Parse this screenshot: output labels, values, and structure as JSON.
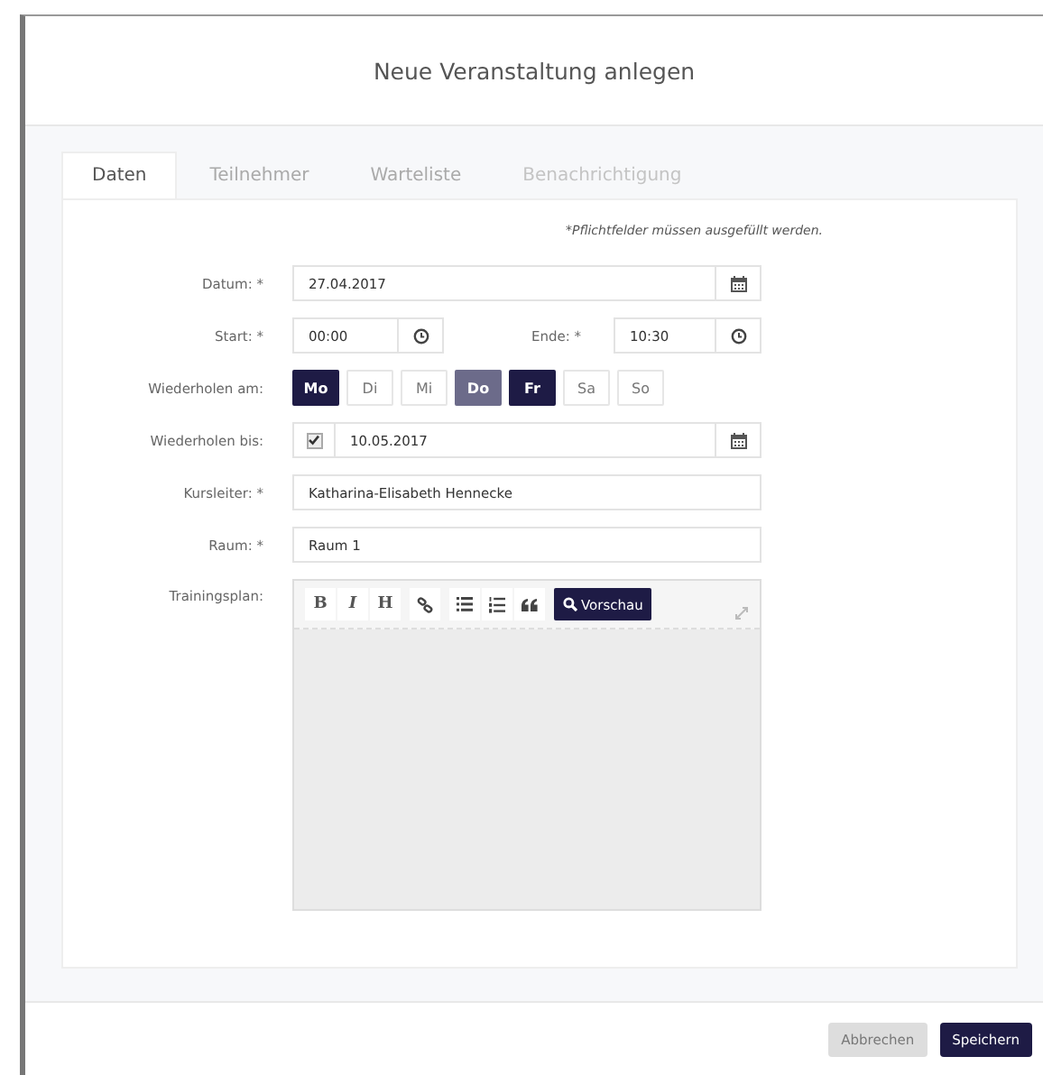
{
  "dialog": {
    "title": "Neue Veranstaltung anlegen"
  },
  "tabs": [
    {
      "label": "Daten",
      "selected": true,
      "disabled": false
    },
    {
      "label": "Teilnehmer",
      "selected": false,
      "disabled": false
    },
    {
      "label": "Warteliste",
      "selected": false,
      "disabled": false
    },
    {
      "label": "Benachrichtigung",
      "selected": false,
      "disabled": true
    }
  ],
  "form": {
    "note": "*Pflichtfelder müssen ausgefüllt werden.",
    "date": {
      "label": "Datum: *",
      "value": "27.04.2017"
    },
    "start": {
      "label": "Start: *",
      "value": "00:00"
    },
    "end": {
      "label": "Ende: *",
      "value": "10:30"
    },
    "repeat_on": {
      "label": "Wiederholen am:",
      "days": [
        {
          "label": "Mo",
          "selected": true,
          "highlighted": false
        },
        {
          "label": "Di",
          "selected": false,
          "highlighted": false
        },
        {
          "label": "Mi",
          "selected": false,
          "highlighted": false
        },
        {
          "label": "Do",
          "selected": false,
          "highlighted": true
        },
        {
          "label": "Fr",
          "selected": true,
          "highlighted": false
        },
        {
          "label": "Sa",
          "selected": false,
          "highlighted": false
        },
        {
          "label": "So",
          "selected": false,
          "highlighted": false
        }
      ]
    },
    "repeat_until": {
      "label": "Wiederholen bis:",
      "checked": true,
      "value": "10.05.2017"
    },
    "instructor": {
      "label": "Kursleiter: *",
      "value": "Katharina-Elisabeth Hennecke"
    },
    "room": {
      "label": "Raum: *",
      "value": "Raum 1"
    },
    "training_plan": {
      "label": "Trainingsplan:",
      "toolbar": [
        [
          {
            "kind": "bold",
            "label": "B"
          },
          {
            "kind": "italic",
            "label": "I"
          },
          {
            "kind": "heading",
            "label": "H"
          }
        ],
        [
          {
            "kind": "link"
          }
        ],
        [
          {
            "kind": "bullets"
          },
          {
            "kind": "numbers"
          },
          {
            "kind": "quote"
          }
        ],
        [
          {
            "kind": "preview",
            "label": "Vorschau"
          }
        ]
      ]
    }
  },
  "buttons": [
    {
      "kind": "secondary",
      "label": "Abbrechen"
    },
    {
      "kind": "primary",
      "label": "Speichern"
    }
  ]
}
